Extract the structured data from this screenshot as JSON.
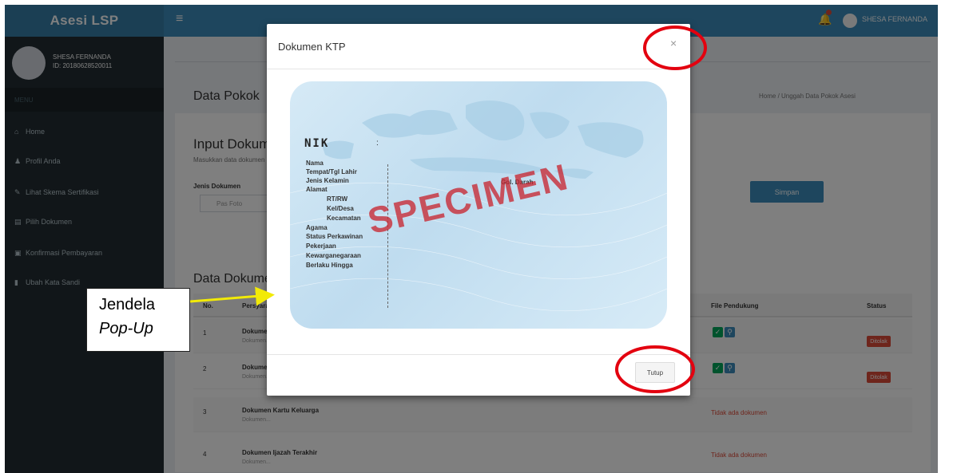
{
  "app": {
    "brand": "Asesi LSP",
    "top_user": "SHESA FERNANDA"
  },
  "sidebar": {
    "user_name": "SHESA FERNANDA",
    "user_id": "ID: 20180628520011",
    "header": "MENU",
    "items": [
      {
        "label": "Home"
      },
      {
        "label": "Profil Anda"
      },
      {
        "label": "Lihat Skema Sertifikasi"
      },
      {
        "label": "Pilih Dokumen"
      },
      {
        "label": "Konfirmasi Pembayaran"
      },
      {
        "label": "Ubah Kata Sandi"
      }
    ]
  },
  "content": {
    "page_title": "Data Pokok",
    "breadcrumb": "Home  /  Unggah Data Pokok Asesi",
    "input_title": "Input Dokumen",
    "input_desc": "Masukkan data dokumen",
    "jenis_label": "Jenis Dokumen",
    "jenis_placeholder": "Pas Foto",
    "simpan_label": "Simpan",
    "data_title": "Data Dokumen",
    "table_headers": {
      "no": "No.",
      "dokumen": "Persyaratan",
      "file": "File Pendukung",
      "status": "Status"
    },
    "rows": [
      {
        "no": "1",
        "name": "Dokumen",
        "sub": "Dokumen...",
        "has_file": true,
        "status": "Ditolak"
      },
      {
        "no": "2",
        "name": "Dokumen",
        "sub": "Dokumen...",
        "has_file": true,
        "status": "Ditolak"
      },
      {
        "no": "3",
        "name": "Dokumen Kartu Keluarga",
        "sub": "Dokumen...",
        "missing": "Tidak ada dokumen"
      },
      {
        "no": "4",
        "name": "Dokumen Ijazah Terakhir",
        "sub": "Dokumen...",
        "missing": "Tidak ada dokumen"
      }
    ]
  },
  "modal": {
    "title": "Dokumen KTP",
    "close_glyph": "×",
    "close_button": "Tutup",
    "ktp": {
      "nik": "NIK",
      "nik_colon": ":",
      "fields": [
        "Nama",
        "Tempat/Tgl Lahir",
        "Jenis Kelamin",
        "Alamat",
        "RT/RW",
        "Kel/Desa",
        "Kecamatan",
        "Agama",
        "Status Perkawinan",
        "Pekerjaan",
        "Kewarganegaraan",
        "Berlaku Hingga"
      ],
      "gol_darah": "Gol. Darah",
      "watermark": "SPECIMEN"
    }
  },
  "annotation": {
    "line1": "Jendela",
    "line2": "Pop-Up",
    "arrow_color": "#f2ea07",
    "circle_color": "#e3000f"
  }
}
